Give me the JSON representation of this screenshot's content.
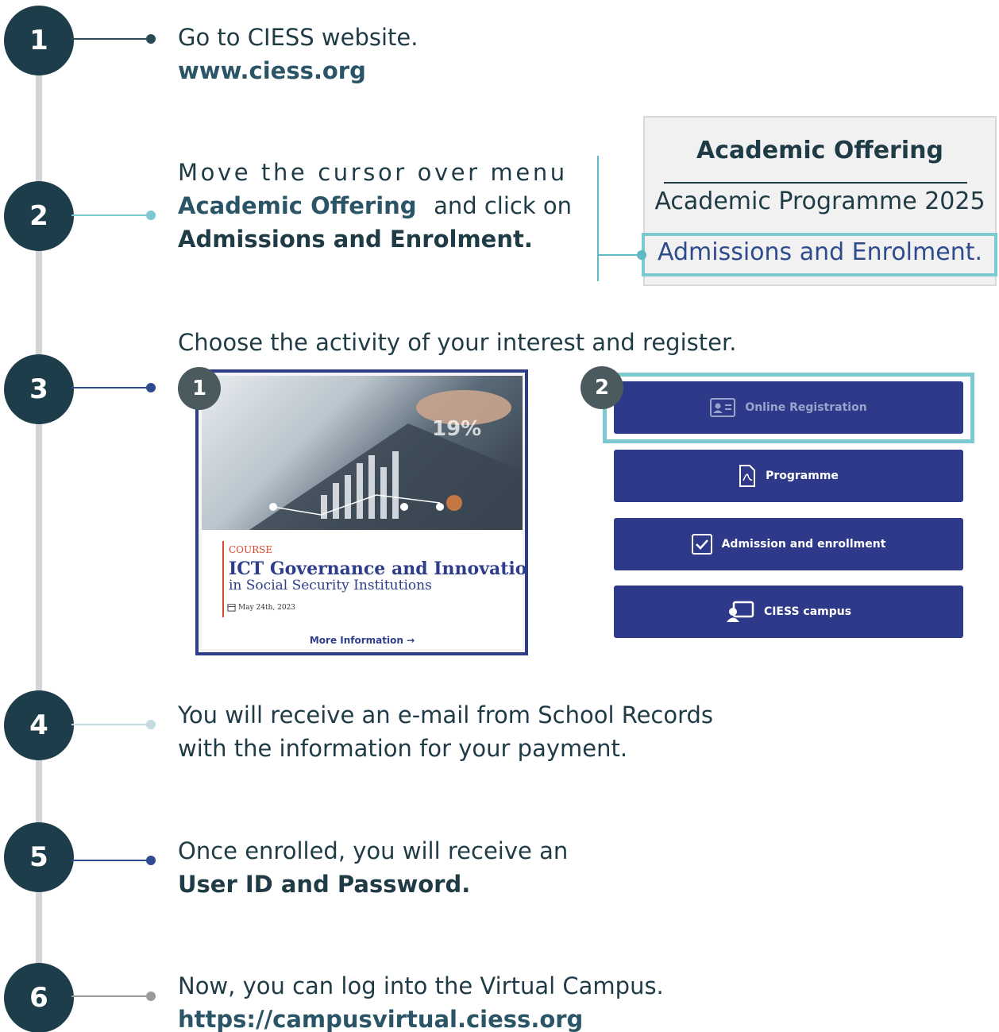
{
  "steps": [
    {
      "number": "1",
      "line1": "Go to CIESS website.",
      "link": "www.ciess.org"
    },
    {
      "number": "2",
      "line1": "Move the cursor over menu",
      "bold1": "Academic Offering",
      "line2_rest": "and click on",
      "bold2": "Admissions and Enrolment."
    },
    {
      "number": "3",
      "line1": "Choose the activity of your interest and register."
    },
    {
      "number": "4",
      "line1": "You will receive an e-mail from School Records",
      "line2": "with the information for your payment."
    },
    {
      "number": "5",
      "line1": "Once enrolled, you will receive an",
      "bold1": "User ID and Password."
    },
    {
      "number": "6",
      "line1": "Now, you can log into the Virtual Campus.",
      "link": "https://campusvirtual.ciess.org"
    }
  ],
  "menu": {
    "title": "Academic Offering",
    "items": [
      "Academic Programme 2025",
      "Admissions and Enrolment."
    ]
  },
  "card": {
    "sub_number": "1",
    "label": "COURSE",
    "title": "ICT Governance and Innovation",
    "subtitle": "in Social Security Institutions",
    "date": "May 24th, 2023",
    "more": "More Information",
    "image_text": "19%"
  },
  "buttons": {
    "sub_number": "2",
    "items": [
      {
        "label": "Online Registration",
        "icon": "id-card-icon"
      },
      {
        "label": "Programme",
        "icon": "pdf-file-icon"
      },
      {
        "label": "Admission and enrollment",
        "icon": "checkbox-icon"
      },
      {
        "label": "CIESS campus",
        "icon": "teacher-board-icon"
      }
    ]
  },
  "colors": {
    "step_circle": "#1e3d4a",
    "button": "#2e3a89",
    "highlight": "#7cc9d1"
  }
}
